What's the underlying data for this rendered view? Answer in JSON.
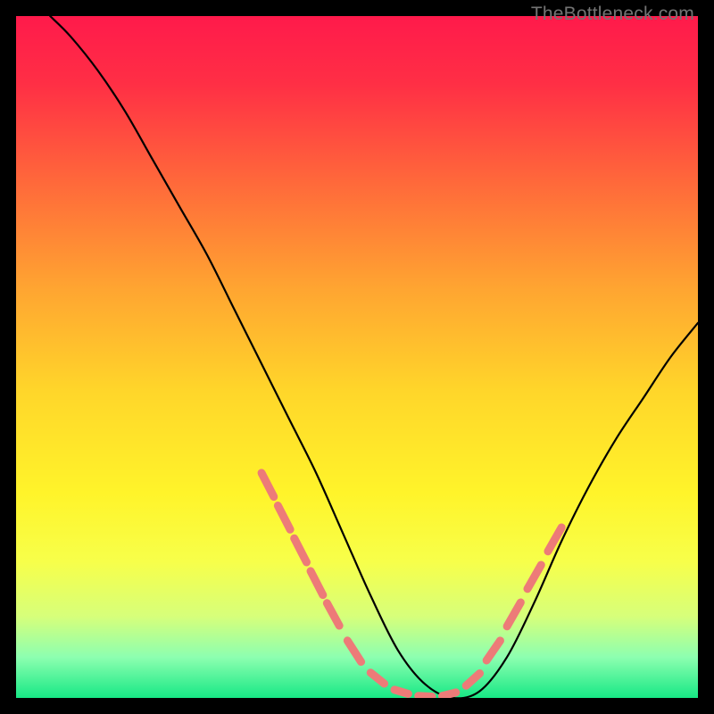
{
  "watermark": "TheBottleneck.com",
  "chart_data": {
    "type": "line",
    "title": "",
    "xlabel": "",
    "ylabel": "",
    "xlim": [
      0,
      100
    ],
    "ylim": [
      0,
      100
    ],
    "grid": false,
    "legend": false,
    "background_gradient": {
      "stops": [
        {
          "offset": 0.0,
          "color": "#ff1a4b"
        },
        {
          "offset": 0.1,
          "color": "#ff2f45"
        },
        {
          "offset": 0.25,
          "color": "#ff6b3a"
        },
        {
          "offset": 0.4,
          "color": "#ffa531"
        },
        {
          "offset": 0.55,
          "color": "#ffd62a"
        },
        {
          "offset": 0.7,
          "color": "#fff42a"
        },
        {
          "offset": 0.8,
          "color": "#f7ff4a"
        },
        {
          "offset": 0.88,
          "color": "#d7ff7a"
        },
        {
          "offset": 0.94,
          "color": "#8dffb0"
        },
        {
          "offset": 1.0,
          "color": "#17e885"
        }
      ]
    },
    "series": [
      {
        "name": "bottleneck-curve",
        "color": "#000000",
        "x": [
          5,
          8,
          12,
          16,
          20,
          24,
          28,
          32,
          36,
          40,
          44,
          48,
          52,
          56,
          60,
          64,
          68,
          72,
          76,
          80,
          84,
          88,
          92,
          96,
          100
        ],
        "y": [
          100,
          97,
          92,
          86,
          79,
          72,
          65,
          57,
          49,
          41,
          33,
          24,
          15,
          7,
          2,
          0,
          1,
          6,
          14,
          23,
          31,
          38,
          44,
          50,
          55
        ]
      }
    ],
    "markers": {
      "name": "highlight-dashes",
      "color": "#ed7b78",
      "segments": [
        {
          "x": [
            36.0,
            37.8
          ],
          "y": [
            33.0,
            29.5
          ]
        },
        {
          "x": [
            38.4,
            40.2
          ],
          "y": [
            28.2,
            24.7
          ]
        },
        {
          "x": [
            40.8,
            42.6
          ],
          "y": [
            23.4,
            19.9
          ]
        },
        {
          "x": [
            43.2,
            45.0
          ],
          "y": [
            18.6,
            15.1
          ]
        },
        {
          "x": [
            45.6,
            47.4
          ],
          "y": [
            13.9,
            10.6
          ]
        },
        {
          "x": [
            48.6,
            50.6
          ],
          "y": [
            8.4,
            5.3
          ]
        },
        {
          "x": [
            52.0,
            54.0
          ],
          "y": [
            3.7,
            2.1
          ]
        },
        {
          "x": [
            55.5,
            57.5
          ],
          "y": [
            1.2,
            0.6
          ]
        },
        {
          "x": [
            59.0,
            61.0
          ],
          "y": [
            0.3,
            0.2
          ]
        },
        {
          "x": [
            62.5,
            64.5
          ],
          "y": [
            0.3,
            0.8
          ]
        },
        {
          "x": [
            66.0,
            68.0
          ],
          "y": [
            1.8,
            3.6
          ]
        },
        {
          "x": [
            69.0,
            71.0
          ],
          "y": [
            5.5,
            8.4
          ]
        },
        {
          "x": [
            72.0,
            74.0
          ],
          "y": [
            10.5,
            14.0
          ]
        },
        {
          "x": [
            75.0,
            77.0
          ],
          "y": [
            16.0,
            19.5
          ]
        },
        {
          "x": [
            78.0,
            80.0
          ],
          "y": [
            21.5,
            25.0
          ]
        }
      ]
    }
  }
}
